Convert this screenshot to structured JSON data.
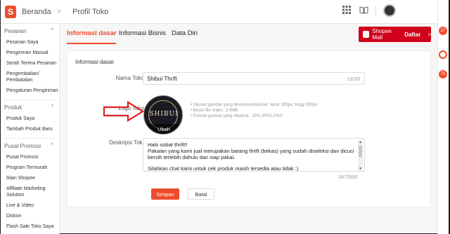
{
  "topbar": {
    "breadcrumb": [
      "Beranda",
      "Profil Toko"
    ],
    "separator": ">"
  },
  "sidebar": {
    "sections": [
      {
        "title": "Pesanan",
        "items": [
          "Pesanan Saya",
          "Pengiriman Massal",
          "Serah Terima Pesanan",
          "Pengembalian/ Pembatalan",
          "Pengaturan Pengiriman"
        ]
      },
      {
        "title": "Produk",
        "items": [
          "Produk Saya",
          "Tambah Produk Baru"
        ]
      },
      {
        "title": "Pusat Promosi",
        "items": [
          "Pusat Promosi",
          "Program Termurah",
          "Iklan Shopee",
          "Affiliate Marketing Solution",
          "Live & Video",
          "Diskon",
          "Flash Sale Toko Saya"
        ]
      }
    ]
  },
  "tabs": [
    "Informasi dasar",
    "Informasi Bisnis",
    "Data Diri"
  ],
  "mall_button": {
    "brand": "Shopee Mall",
    "action": "Daftar",
    "chevron": ">"
  },
  "form": {
    "section_title": "Informasi dasar",
    "shop_name_label": "Nama Toko",
    "shop_name_value": "Shibui Thrift",
    "shop_name_count": "13/30",
    "logo_label": "Logo Toko",
    "logo_text": "SHIBUI",
    "logo_change": "Ubah",
    "hints": [
      "• Ukuran gambar yang direkomendasikan: lebar 300px, tinggi 300px",
      "• Besar file maks.: 2.0MB",
      "• Format gambar yang diterima : JPG,JPEG,PNG"
    ],
    "description_label": "Deskripsi Toko",
    "description_lines": [
      "Halo sobat thrift!!",
      "Pakaian yang kami jual merupakan barang thrift (bekas)  yang sudah diseleksi dan dicuci bersih terlebih dahulu dan siap pakai.",
      "",
      "Silahkan chat kami untuk cek produk masih tersedia atau tidak :)"
    ],
    "description_count": "347/500",
    "save_label": "Simpan",
    "cancel_label": "Batal"
  },
  "badges": [
    "27",
    "",
    "75"
  ],
  "colors": {
    "accent": "#ee4d2d",
    "mall": "#d0011b",
    "arrow": "#e02020"
  }
}
